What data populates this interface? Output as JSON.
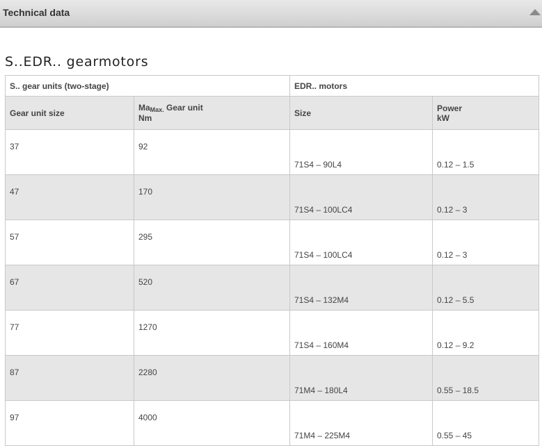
{
  "header": {
    "title": "Technical data"
  },
  "page_title": "S..EDR.. gearmotors",
  "table": {
    "group_headers": [
      "S.. gear units (two-stage)",
      "EDR.. motors"
    ],
    "columns": {
      "gear_unit_size": "Gear unit size",
      "torque_prefix": "Ma",
      "torque_sub": "Max.",
      "torque_suffix": " Gear unit",
      "torque_unit": "Nm",
      "motor_size": "Size",
      "power": "Power",
      "power_unit": "kW"
    },
    "rows": [
      {
        "gear_size": "37",
        "torque": "92",
        "motor_size": "71S4 – 90L4",
        "power": "0.12 – 1.5"
      },
      {
        "gear_size": "47",
        "torque": "170",
        "motor_size": "71S4 – 100LC4",
        "power": "0.12 – 3"
      },
      {
        "gear_size": "57",
        "torque": "295",
        "motor_size": "71S4 – 100LC4",
        "power": "0.12 – 3"
      },
      {
        "gear_size": "67",
        "torque": "520",
        "motor_size": "71S4 – 132M4",
        "power": "0.12 – 5.5"
      },
      {
        "gear_size": "77",
        "torque": "1270",
        "motor_size": "71S4 – 160M4",
        "power": "0.12 – 9.2"
      },
      {
        "gear_size": "87",
        "torque": "2280",
        "motor_size": "71M4 – 180L4",
        "power": "0.55 – 18.5"
      },
      {
        "gear_size": "97",
        "torque": "4000",
        "motor_size": "71M4 – 225M4",
        "power": "0.55 – 45"
      }
    ]
  }
}
